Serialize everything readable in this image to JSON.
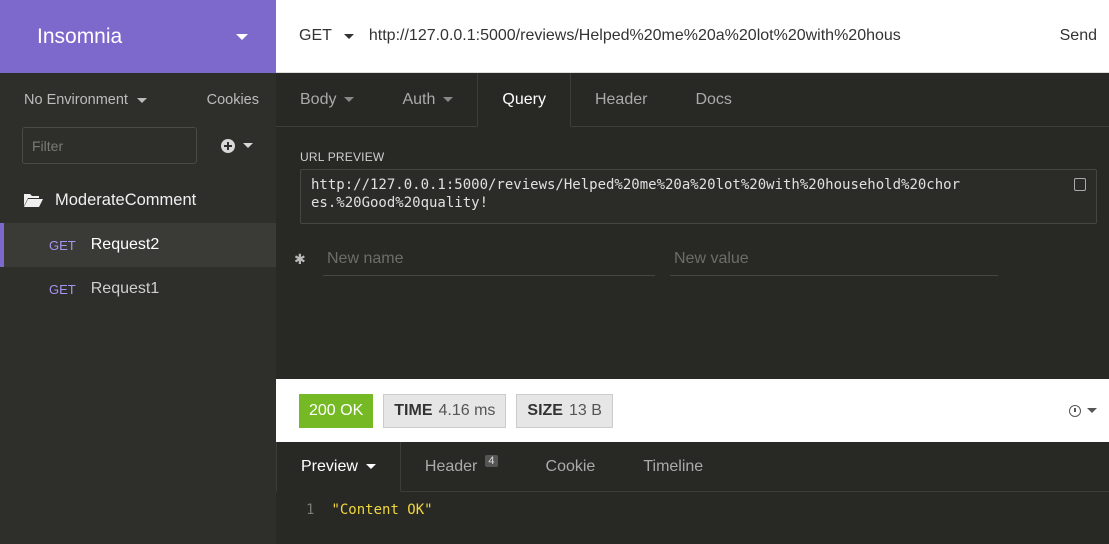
{
  "app": {
    "name": "Insomnia"
  },
  "sidebar": {
    "environment": "No Environment",
    "cookies": "Cookies",
    "filter_placeholder": "Filter",
    "folder": "ModerateComment",
    "requests": [
      {
        "method": "GET",
        "name": "Request2",
        "active": true
      },
      {
        "method": "GET",
        "name": "Request1",
        "active": false
      }
    ]
  },
  "urlbar": {
    "method": "GET",
    "url": "http://127.0.0.1:5000/reviews/Helped%20me%20a%20lot%20with%20hous",
    "send": "Send"
  },
  "request_tabs": [
    {
      "label": "Body",
      "dropdown": true
    },
    {
      "label": "Auth",
      "dropdown": true
    },
    {
      "label": "Query",
      "active": true
    },
    {
      "label": "Header"
    },
    {
      "label": "Docs"
    }
  ],
  "query": {
    "preview_label": "URL PREVIEW",
    "preview_line1": "http://127.0.0.1:5000/reviews/Helped%20me%20a%20lot%20with%20household%20chor",
    "preview_line2": "es.%20Good%20quality!",
    "name_placeholder": "New name",
    "value_placeholder": "New value"
  },
  "response": {
    "status": "200 OK",
    "time_label": "TIME",
    "time_value": "4.16 ms",
    "size_label": "SIZE",
    "size_value": "13 B",
    "tabs": [
      {
        "label": "Preview",
        "active": true,
        "dropdown": true
      },
      {
        "label": "Header",
        "count": "4"
      },
      {
        "label": "Cookie"
      },
      {
        "label": "Timeline"
      }
    ],
    "body_line_no": "1",
    "body": "\"Content OK\""
  },
  "colors": {
    "brand": "#7d69cb",
    "status_ok": "#75ba24",
    "string": "#f0d640"
  }
}
